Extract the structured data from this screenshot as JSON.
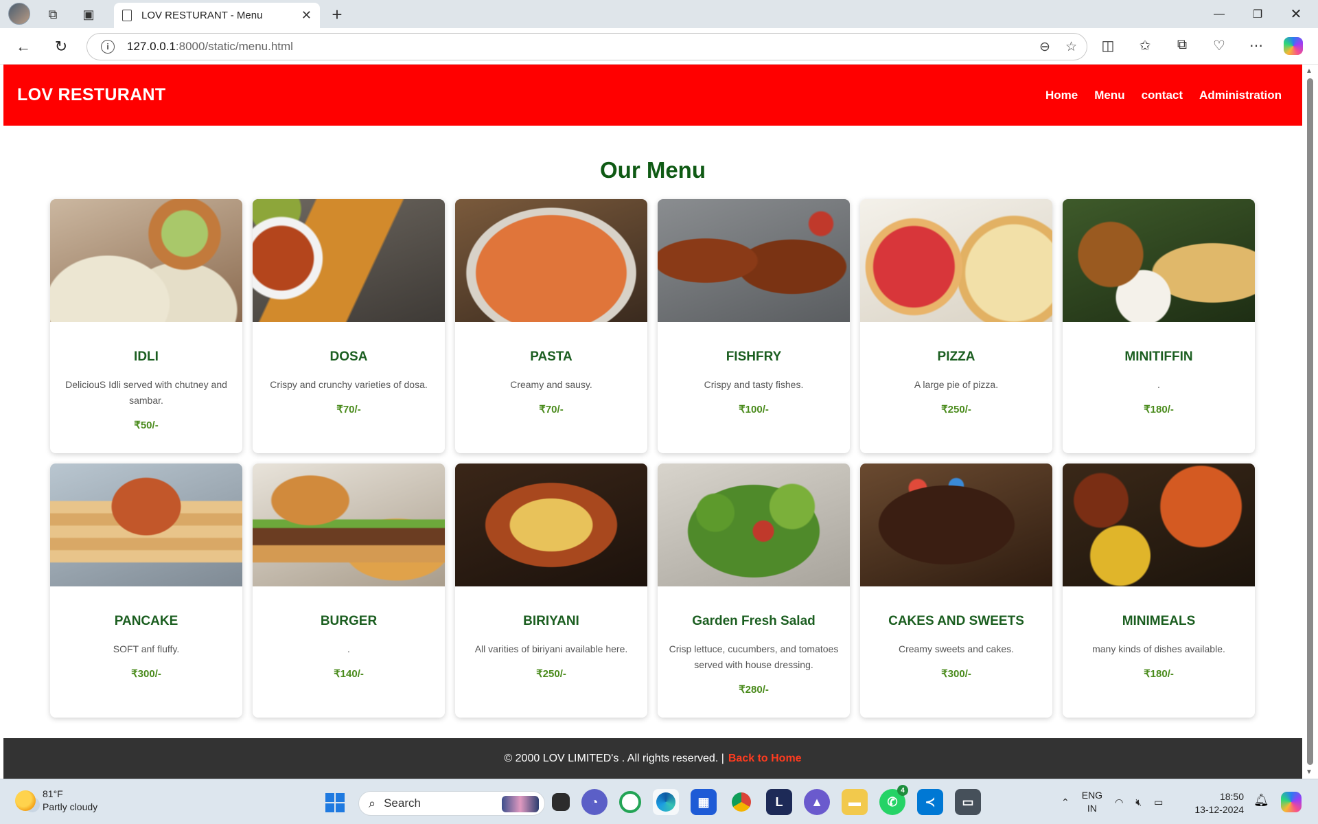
{
  "browser": {
    "tab_title": "LOV RESTURANT - Menu",
    "url_host": "127.0.0.1",
    "url_rest": ":8000/static/menu.html"
  },
  "site": {
    "brand": "LOV RESTURANT",
    "nav": [
      {
        "label": "Home"
      },
      {
        "label": "Menu"
      },
      {
        "label": "contact"
      },
      {
        "label": "Administration"
      }
    ],
    "menu_title": "Our Menu",
    "items": [
      {
        "name": "IDLI",
        "desc": "DeliciouS Idli served with chutney and sambar.",
        "price": "₹50/-",
        "image": "idli-photo"
      },
      {
        "name": "DOSA",
        "desc": "Crispy and crunchy varieties of dosa.",
        "price": "₹70/-",
        "image": "dosa-photo"
      },
      {
        "name": "PASTA",
        "desc": "Creamy and sausy.",
        "price": "₹70/-",
        "image": "pasta-photo"
      },
      {
        "name": "FISHFRY",
        "desc": "Crispy and tasty fishes.",
        "price": "₹100/-",
        "image": "fishfry-photo"
      },
      {
        "name": "PIZZA",
        "desc": "A large pie of pizza.",
        "price": "₹250/-",
        "image": "pizza-photo"
      },
      {
        "name": "MINITIFFIN",
        "desc": ".",
        "price": "₹180/-",
        "image": "minitiffin-photo"
      },
      {
        "name": "PANCAKE",
        "desc": "SOFT anf fluffy.",
        "price": "₹300/-",
        "image": "pancake-photo"
      },
      {
        "name": "BURGER",
        "desc": ".",
        "price": "₹140/-",
        "image": "burger-photo"
      },
      {
        "name": "BIRIYANI",
        "desc": "All varities of biriyani available here.",
        "price": "₹250/-",
        "image": "biriyani-photo"
      },
      {
        "name": "Garden Fresh Salad",
        "desc": "Crisp lettuce, cucumbers, and tomatoes served with house dressing.",
        "price": "₹280/-",
        "image": "salad-photo"
      },
      {
        "name": "CAKES AND SWEETS",
        "desc": "Creamy sweets and cakes.",
        "price": "₹300/-",
        "image": "cake-photo"
      },
      {
        "name": "MINIMEALS",
        "desc": "many kinds of dishes available.",
        "price": "₹180/-",
        "image": "minimeals-photo"
      }
    ],
    "footer_text": "© 2000 LOV LIMITED's . All rights reserved. |",
    "footer_link": "Back to Home"
  },
  "taskbar": {
    "weather_temp": "81°F",
    "weather_desc": "Partly cloudy",
    "search_placeholder": "Search",
    "whatsapp_badge": "4",
    "lang_line1": "ENG",
    "lang_line2": "IN",
    "time": "18:50",
    "date": "13-12-2024"
  }
}
